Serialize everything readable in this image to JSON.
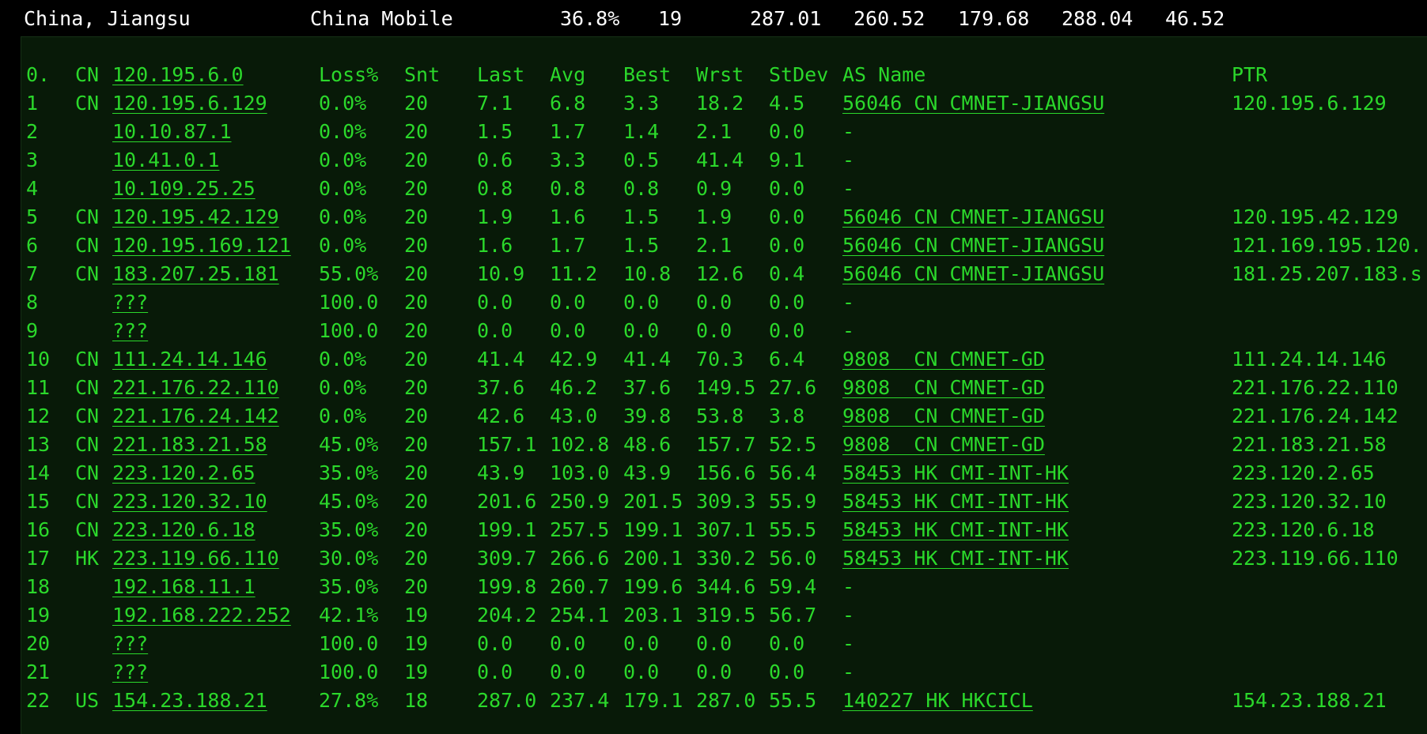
{
  "summary": {
    "location": "China, Jiangsu",
    "isp": "China Mobile",
    "loss": "36.8%",
    "snt": "19",
    "last": "287.01",
    "avg": "260.52",
    "best": "179.68",
    "wrst": "288.04",
    "stdev": "46.52"
  },
  "header": {
    "hop": "0.",
    "cc": "CN",
    "host": "120.195.6.0",
    "loss": "Loss%",
    "snt": "Snt",
    "last": "Last",
    "avg": "Avg",
    "best": "Best",
    "wrst": "Wrst",
    "stdev": "StDev",
    "asname": "AS Name",
    "ptr": "PTR"
  },
  "colors": {
    "text_green": "#2bd82b",
    "panel_bg": "#081a08",
    "summary_text": "#ffffff",
    "page_bg": "#000000"
  },
  "hops": [
    {
      "hop": "1",
      "cc": "CN",
      "host": "120.195.6.129",
      "loss": "0.0%",
      "snt": "20",
      "last": "7.1",
      "avg": "6.8",
      "best": "3.3",
      "wrst": "18.2",
      "stdev": "4.5",
      "asname": "56046 CN CMNET-JIANGSU",
      "ptr": "120.195.6.129"
    },
    {
      "hop": "2",
      "cc": "",
      "host": "10.10.87.1",
      "loss": "0.0%",
      "snt": "20",
      "last": "1.5",
      "avg": "1.7",
      "best": "1.4",
      "wrst": "2.1",
      "stdev": "0.0",
      "asname": "-",
      "ptr": ""
    },
    {
      "hop": "3",
      "cc": "",
      "host": "10.41.0.1",
      "loss": "0.0%",
      "snt": "20",
      "last": "0.6",
      "avg": "3.3",
      "best": "0.5",
      "wrst": "41.4",
      "stdev": "9.1",
      "asname": "-",
      "ptr": ""
    },
    {
      "hop": "4",
      "cc": "",
      "host": "10.109.25.25",
      "loss": "0.0%",
      "snt": "20",
      "last": "0.8",
      "avg": "0.8",
      "best": "0.8",
      "wrst": "0.9",
      "stdev": "0.0",
      "asname": "-",
      "ptr": ""
    },
    {
      "hop": "5",
      "cc": "CN",
      "host": "120.195.42.129",
      "loss": "0.0%",
      "snt": "20",
      "last": "1.9",
      "avg": "1.6",
      "best": "1.5",
      "wrst": "1.9",
      "stdev": "0.0",
      "asname": "56046 CN CMNET-JIANGSU",
      "ptr": "120.195.42.129"
    },
    {
      "hop": "6",
      "cc": "CN",
      "host": "120.195.169.121",
      "loss": "0.0%",
      "snt": "20",
      "last": "1.6",
      "avg": "1.7",
      "best": "1.5",
      "wrst": "2.1",
      "stdev": "0.0",
      "asname": "56046 CN CMNET-JIANGSU",
      "ptr": "121.169.195.120."
    },
    {
      "hop": "7",
      "cc": "CN",
      "host": "183.207.25.181",
      "loss": "55.0%",
      "snt": "20",
      "last": "10.9",
      "avg": "11.2",
      "best": "10.8",
      "wrst": "12.6",
      "stdev": "0.4",
      "asname": "56046 CN CMNET-JIANGSU",
      "ptr": "181.25.207.183.s"
    },
    {
      "hop": "8",
      "cc": "",
      "host": "???",
      "loss": "100.0",
      "snt": "20",
      "last": "0.0",
      "avg": "0.0",
      "best": "0.0",
      "wrst": "0.0",
      "stdev": "0.0",
      "asname": "-",
      "ptr": ""
    },
    {
      "hop": "9",
      "cc": "",
      "host": "???",
      "loss": "100.0",
      "snt": "20",
      "last": "0.0",
      "avg": "0.0",
      "best": "0.0",
      "wrst": "0.0",
      "stdev": "0.0",
      "asname": "-",
      "ptr": ""
    },
    {
      "hop": "10",
      "cc": "CN",
      "host": "111.24.14.146",
      "loss": "0.0%",
      "snt": "20",
      "last": "41.4",
      "avg": "42.9",
      "best": "41.4",
      "wrst": "70.3",
      "stdev": "6.4",
      "asname": "9808  CN CMNET-GD",
      "ptr": "111.24.14.146"
    },
    {
      "hop": "11",
      "cc": "CN",
      "host": "221.176.22.110",
      "loss": "0.0%",
      "snt": "20",
      "last": "37.6",
      "avg": "46.2",
      "best": "37.6",
      "wrst": "149.5",
      "stdev": "27.6",
      "asname": "9808  CN CMNET-GD",
      "ptr": "221.176.22.110"
    },
    {
      "hop": "12",
      "cc": "CN",
      "host": "221.176.24.142",
      "loss": "0.0%",
      "snt": "20",
      "last": "42.6",
      "avg": "43.0",
      "best": "39.8",
      "wrst": "53.8",
      "stdev": "3.8",
      "asname": "9808  CN CMNET-GD",
      "ptr": "221.176.24.142"
    },
    {
      "hop": "13",
      "cc": "CN",
      "host": "221.183.21.58",
      "loss": "45.0%",
      "snt": "20",
      "last": "157.1",
      "avg": "102.8",
      "best": "48.6",
      "wrst": "157.7",
      "stdev": "52.5",
      "asname": "9808  CN CMNET-GD",
      "ptr": "221.183.21.58"
    },
    {
      "hop": "14",
      "cc": "CN",
      "host": "223.120.2.65",
      "loss": "35.0%",
      "snt": "20",
      "last": "43.9",
      "avg": "103.0",
      "best": "43.9",
      "wrst": "156.6",
      "stdev": "56.4",
      "asname": "58453 HK CMI-INT-HK",
      "ptr": "223.120.2.65"
    },
    {
      "hop": "15",
      "cc": "CN",
      "host": "223.120.32.10",
      "loss": "45.0%",
      "snt": "20",
      "last": "201.6",
      "avg": "250.9",
      "best": "201.5",
      "wrst": "309.3",
      "stdev": "55.9",
      "asname": "58453 HK CMI-INT-HK",
      "ptr": "223.120.32.10"
    },
    {
      "hop": "16",
      "cc": "CN",
      "host": "223.120.6.18",
      "loss": "35.0%",
      "snt": "20",
      "last": "199.1",
      "avg": "257.5",
      "best": "199.1",
      "wrst": "307.1",
      "stdev": "55.5",
      "asname": "58453 HK CMI-INT-HK",
      "ptr": "223.120.6.18"
    },
    {
      "hop": "17",
      "cc": "HK",
      "host": "223.119.66.110",
      "loss": "30.0%",
      "snt": "20",
      "last": "309.7",
      "avg": "266.6",
      "best": "200.1",
      "wrst": "330.2",
      "stdev": "56.0",
      "asname": "58453 HK CMI-INT-HK",
      "ptr": "223.119.66.110"
    },
    {
      "hop": "18",
      "cc": "",
      "host": "192.168.11.1",
      "loss": "35.0%",
      "snt": "20",
      "last": "199.8",
      "avg": "260.7",
      "best": "199.6",
      "wrst": "344.6",
      "stdev": "59.4",
      "asname": "-",
      "ptr": ""
    },
    {
      "hop": "19",
      "cc": "",
      "host": "192.168.222.252",
      "loss": "42.1%",
      "snt": "19",
      "last": "204.2",
      "avg": "254.1",
      "best": "203.1",
      "wrst": "319.5",
      "stdev": "56.7",
      "asname": "-",
      "ptr": ""
    },
    {
      "hop": "20",
      "cc": "",
      "host": "???",
      "loss": "100.0",
      "snt": "19",
      "last": "0.0",
      "avg": "0.0",
      "best": "0.0",
      "wrst": "0.0",
      "stdev": "0.0",
      "asname": "-",
      "ptr": ""
    },
    {
      "hop": "21",
      "cc": "",
      "host": "???",
      "loss": "100.0",
      "snt": "19",
      "last": "0.0",
      "avg": "0.0",
      "best": "0.0",
      "wrst": "0.0",
      "stdev": "0.0",
      "asname": "-",
      "ptr": ""
    },
    {
      "hop": "22",
      "cc": "US",
      "host": "154.23.188.21",
      "loss": "27.8%",
      "snt": "18",
      "last": "287.0",
      "avg": "237.4",
      "best": "179.1",
      "wrst": "287.0",
      "stdev": "55.5",
      "asname": "140227 HK HKCICL",
      "ptr": "154.23.188.21"
    }
  ]
}
